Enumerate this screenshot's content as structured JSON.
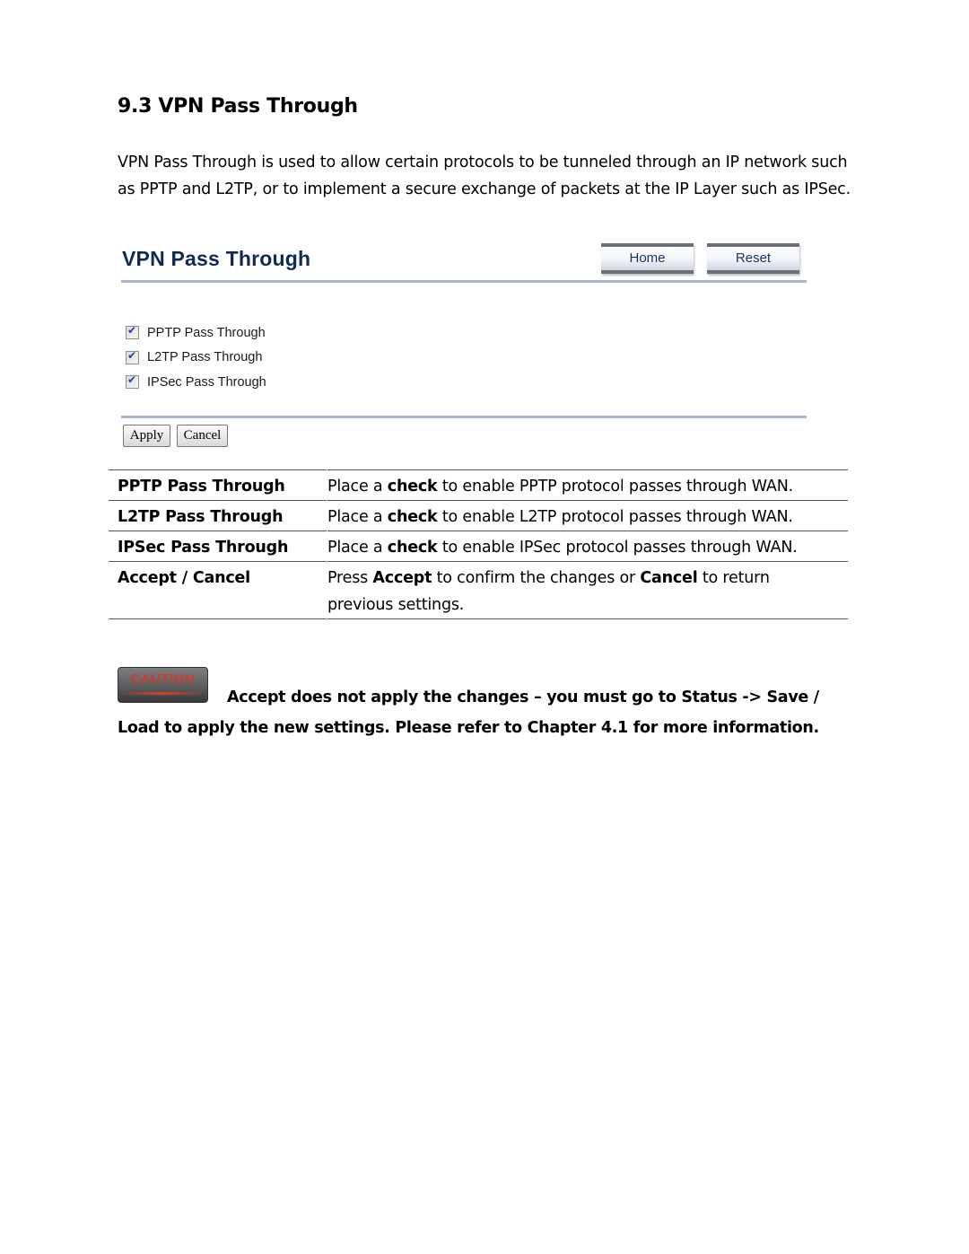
{
  "document": {
    "section_title": "9.3 VPN Pass Through",
    "intro": "VPN Pass Through is used to allow certain protocols to be tunneled through an IP network such as PPTP and L2TP, or to implement a secure exchange of packets at the IP Layer such as IPSec."
  },
  "ui": {
    "title": "VPN Pass Through",
    "home_label": "Home",
    "reset_label": "Reset",
    "options": [
      {
        "label": "PPTP Pass Through",
        "checked": true
      },
      {
        "label": "L2TP Pass Through",
        "checked": true
      },
      {
        "label": "IPSec Pass Through",
        "checked": true
      }
    ],
    "apply_label": "Apply",
    "cancel_label": "Cancel",
    "colors": {
      "title": "#112a55",
      "rule": "#a9b5cf",
      "check": "#2b3f9c"
    }
  },
  "table": {
    "rows": [
      {
        "term": "PPTP Pass Through",
        "pre": "Place a ",
        "b1": "check",
        "mid": " to enable PPTP protocol passes through WAN.",
        "b2": "",
        "post": ""
      },
      {
        "term": "L2TP Pass Through",
        "pre": "Place a ",
        "b1": "check",
        "mid": " to enable L2TP protocol passes through WAN.",
        "b2": "",
        "post": ""
      },
      {
        "term": "IPSec Pass Through",
        "pre": "Place a ",
        "b1": "check",
        "mid": " to enable IPSec protocol passes through WAN.",
        "b2": "",
        "post": ""
      },
      {
        "term": "Accept / Cancel",
        "pre": "Press ",
        "b1": "Accept",
        "mid": " to confirm the changes or ",
        "b2": "Cancel",
        "post": " to return previous settings."
      }
    ]
  },
  "caution": {
    "badge_label": "CAUTION",
    "text": "Accept does not apply the changes – you must go to Status -> Save / Load to apply the new settings. Please refer to Chapter 4.1 for more information.",
    "badge_color": "#d23a2c"
  }
}
